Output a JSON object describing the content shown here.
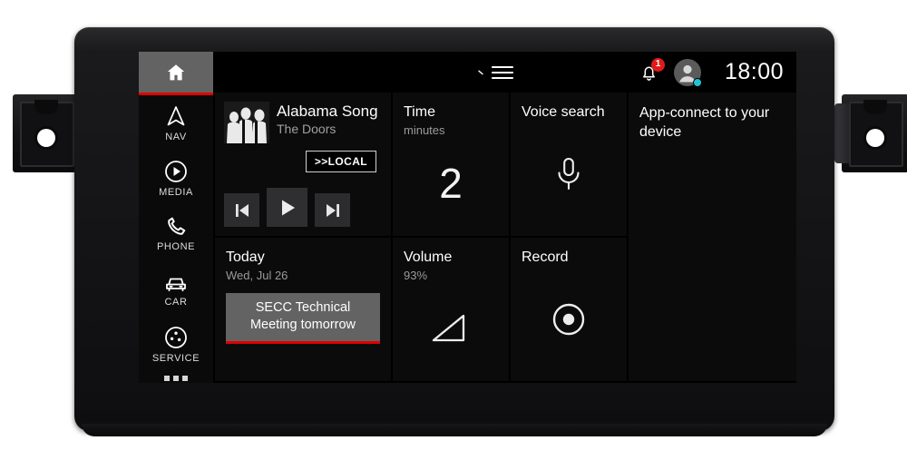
{
  "sidebar": {
    "items": [
      {
        "label": "",
        "icon": "home-icon",
        "name": "home",
        "active": true
      },
      {
        "label": "NAV",
        "icon": "navigation-arrow-icon",
        "name": "nav",
        "active": false
      },
      {
        "label": "MEDIA",
        "icon": "play-circle-icon",
        "name": "media",
        "active": false
      },
      {
        "label": "PHONE",
        "icon": "phone-handset-icon",
        "name": "phone",
        "active": false
      },
      {
        "label": "CAR",
        "icon": "car-icon",
        "name": "car",
        "active": false
      },
      {
        "label": "SERVICE",
        "icon": "service-gear-icon",
        "name": "service",
        "active": false
      }
    ],
    "more_icon": "more-dots-icon"
  },
  "statusbar": {
    "menu_icon": "hamburger-menu-icon",
    "menu_chevron_icon": "chevron-down-icon",
    "bell_icon": "notification-bell-icon",
    "notification_count": "1",
    "avatar_icon": "user-avatar-icon",
    "avatar_status": "online",
    "clock": "18:00"
  },
  "tiles": {
    "media": {
      "track_title": "Alabama Song",
      "artist": "The Doors",
      "source_button": ">>LOCAL",
      "album_art": "band-photo-thumbnail",
      "prev_icon": "skip-previous-icon",
      "play_icon": "play-icon",
      "next_icon": "skip-next-icon"
    },
    "time": {
      "title": "Time",
      "subtitle": "minutes",
      "value": "2"
    },
    "voice": {
      "title": "Voice search",
      "icon": "microphone-icon"
    },
    "appconnect": {
      "text": "App-connect to your device"
    },
    "today": {
      "title": "Today",
      "date": "Wed, Jul 26",
      "event": "SECC Technical Meeting tomorrow"
    },
    "volume": {
      "title": "Volume",
      "value": "93%",
      "icon": "volume-wedge-icon"
    },
    "record": {
      "title": "Record",
      "icon": "record-circle-icon"
    }
  },
  "colors": {
    "accent_red": "#e00000",
    "badge_red": "#e01b1b",
    "status_cyan": "#1fc3d6",
    "tile_bg": "#0b0b0c",
    "active_bg": "#636363"
  }
}
